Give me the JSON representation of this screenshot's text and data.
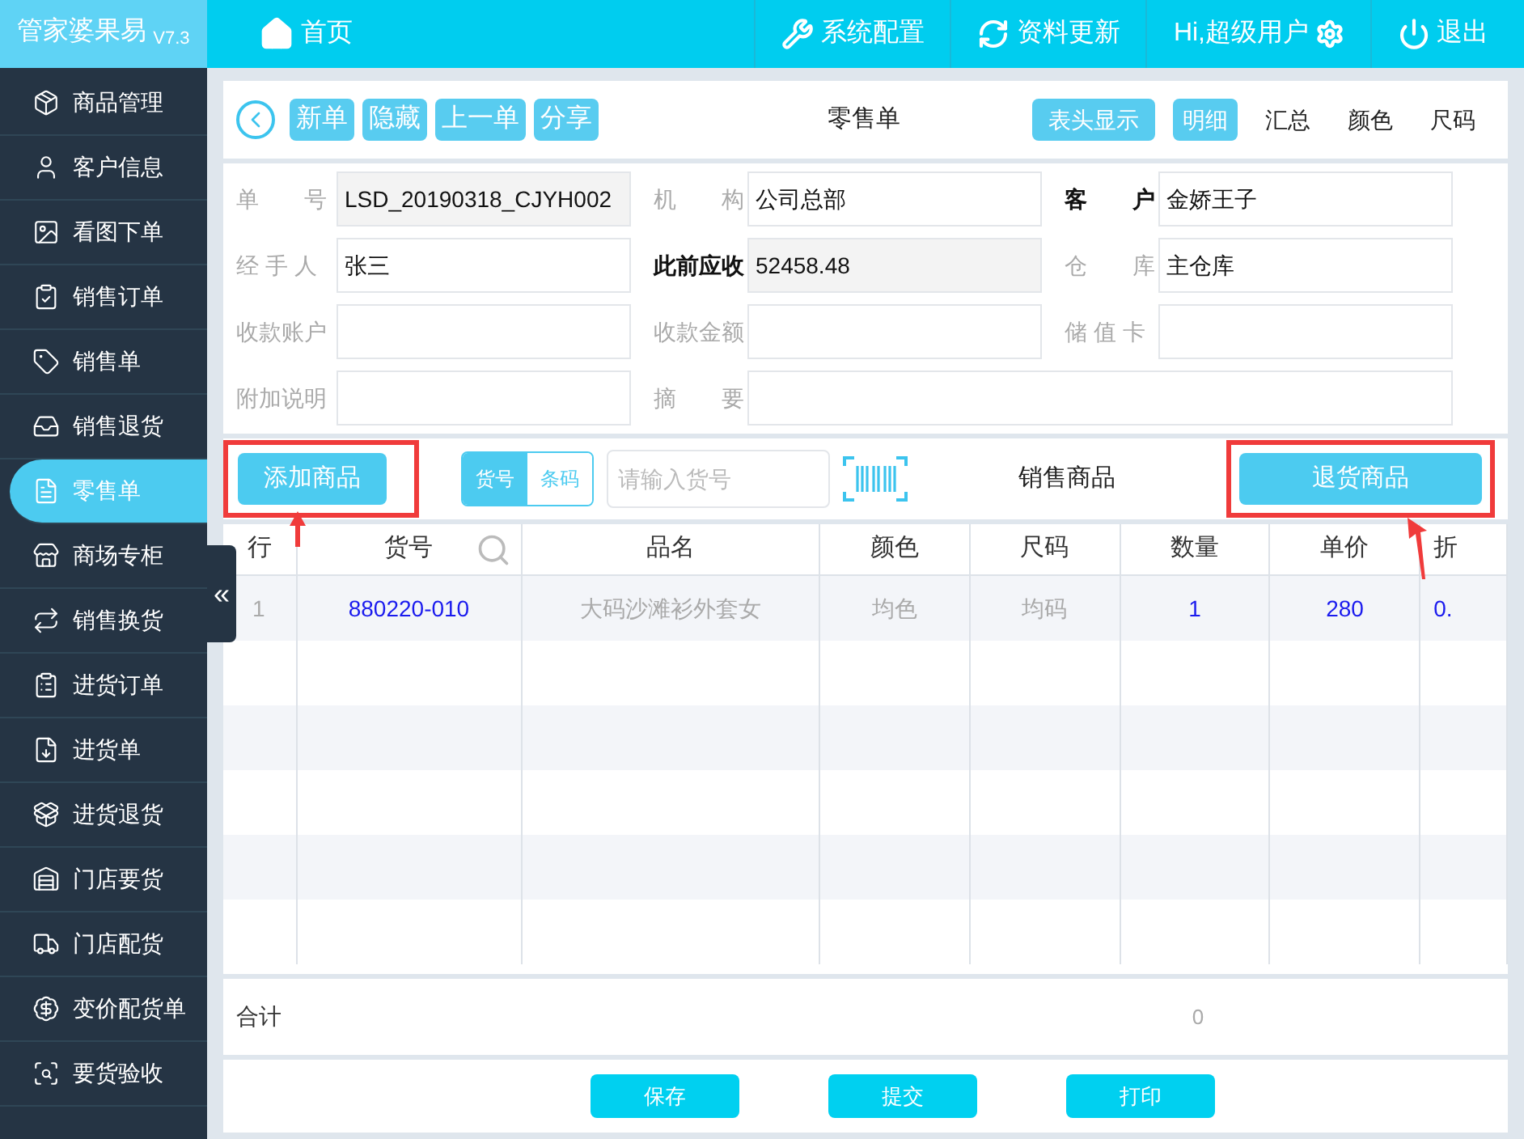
{
  "app": {
    "name": "管家婆果易",
    "version": "V7.3"
  },
  "topnav": {
    "home": "首页",
    "items": [
      {
        "kind": "settings",
        "label": "系统配置"
      },
      {
        "kind": "refresh",
        "label": "资料更新"
      },
      {
        "kind": "user",
        "label": "Hi,超级用户"
      },
      {
        "kind": "logout",
        "label": "退出"
      }
    ]
  },
  "sidebar": {
    "items": [
      {
        "label": "商品管理",
        "selected": false
      },
      {
        "label": "客户信息",
        "selected": false
      },
      {
        "label": "看图下单",
        "selected": false
      },
      {
        "label": "销售订单",
        "selected": false
      },
      {
        "label": "销售单",
        "selected": false
      },
      {
        "label": "销售退货",
        "selected": false
      },
      {
        "label": "零售单",
        "selected": true
      },
      {
        "label": "商场专柜",
        "selected": false
      },
      {
        "label": "销售换货",
        "selected": false
      },
      {
        "label": "进货订单",
        "selected": false
      },
      {
        "label": "进货单",
        "selected": false
      },
      {
        "label": "进货退货",
        "selected": false
      },
      {
        "label": "门店要货",
        "selected": false
      },
      {
        "label": "门店配货",
        "selected": false
      },
      {
        "label": "变价配货单",
        "selected": false
      },
      {
        "label": "要货验收",
        "selected": false
      }
    ],
    "collapse": "«"
  },
  "toolbar": {
    "actions": [
      "新单",
      "隐藏",
      "上一单",
      "分享"
    ],
    "title": "零售单",
    "header_toggle": "表头显示",
    "views": [
      {
        "label": "明细",
        "selected": true
      },
      {
        "label": "汇总",
        "selected": false
      },
      {
        "label": "颜色",
        "selected": false
      },
      {
        "label": "尺码",
        "selected": false
      }
    ]
  },
  "form": {
    "fields": [
      {
        "label": "单　　号",
        "value": "LSD_20190318_CJYH002",
        "readonly": true,
        "emphasized": false,
        "wide": false
      },
      {
        "label": "机　　构",
        "value": "公司总部",
        "readonly": false,
        "emphasized": false,
        "wide": false
      },
      {
        "label": "客　　户",
        "value": "金娇王子",
        "readonly": false,
        "emphasized": true,
        "wide": false
      },
      {
        "label": "经 手 人",
        "value": "张三",
        "readonly": false,
        "emphasized": false,
        "wide": false
      },
      {
        "label": "此前应收",
        "value": "52458.48",
        "readonly": true,
        "emphasized": true,
        "wide": false
      },
      {
        "label": "仓　　库",
        "value": "主仓库",
        "readonly": false,
        "emphasized": false,
        "wide": false
      },
      {
        "label": "收款账户",
        "readonly": false,
        "emphasized": false,
        "wide": false
      },
      {
        "label": "收款金额",
        "readonly": false,
        "emphasized": false,
        "wide": false
      },
      {
        "label": "储 值 卡",
        "readonly": false,
        "emphasized": false,
        "wide": false
      },
      {
        "label": "附加说明",
        "readonly": false,
        "emphasized": false,
        "wide": false
      },
      {
        "label": "摘　　要",
        "readonly": false,
        "emphasized": false,
        "wide": true
      }
    ]
  },
  "entry_bar": {
    "add_button": "添加商品",
    "modes": [
      {
        "label": "货号",
        "selected": true
      },
      {
        "label": "条码",
        "selected": false
      }
    ],
    "search": {
      "placeholder": "请输入货号"
    },
    "section": "销售商品",
    "return_button": "退货商品"
  },
  "table": {
    "columns": [
      {
        "label": "行",
        "accent": false
      },
      {
        "label": "货号",
        "accent": true
      },
      {
        "label": "品名",
        "accent": false
      },
      {
        "label": "颜色",
        "accent": false
      },
      {
        "label": "尺码",
        "accent": false
      },
      {
        "label": "数量",
        "accent": true
      },
      {
        "label": "单价",
        "accent": true
      },
      {
        "label": "折",
        "accent": true
      }
    ],
    "rows": [
      [
        "1",
        "880220-010",
        "大码沙滩衫外套女",
        "均色",
        "均码",
        "1",
        "280",
        "0."
      ]
    ],
    "total": {
      "label": "合计",
      "quantity": "0"
    }
  },
  "footer": {
    "buttons": [
      "保存",
      "提交",
      "打印"
    ]
  }
}
